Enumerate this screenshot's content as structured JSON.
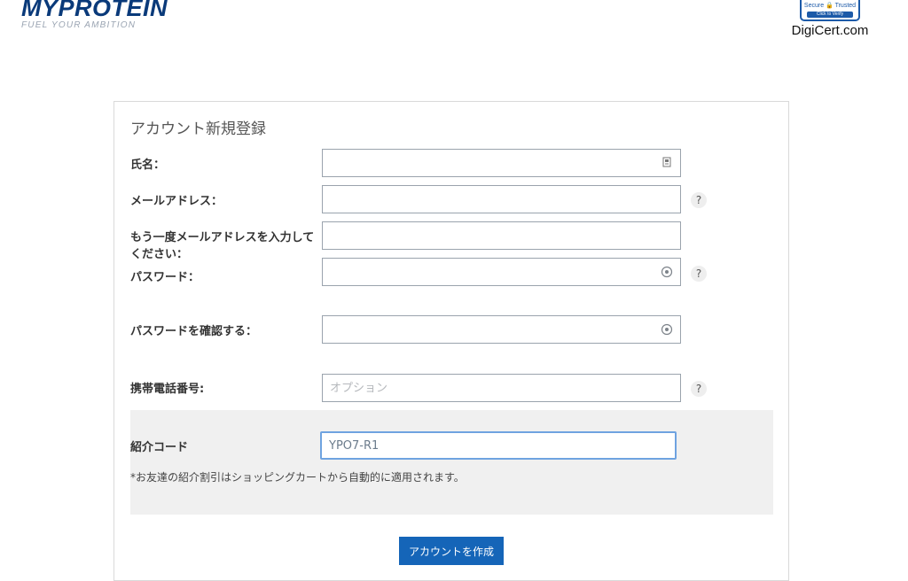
{
  "header": {
    "logo": "MYPROTEIN",
    "tagline": "FUEL YOUR AMBITION",
    "seal": {
      "secure_text": "Secure 🔒 Trusted",
      "verify_text": "Click to Verify",
      "name": "DigiCert.com"
    }
  },
  "form": {
    "title": "アカウント新規登録",
    "fields": {
      "name": {
        "label": "氏名：",
        "value": "",
        "placeholder": ""
      },
      "email": {
        "label": "メールアドレス：",
        "value": "",
        "placeholder": ""
      },
      "email_confirm": {
        "label_line1": "もう一度メールアドレスを入力して",
        "label_line2": "ください：",
        "value": "",
        "placeholder": ""
      },
      "password": {
        "label": "パスワード：",
        "value": "",
        "placeholder": ""
      },
      "password_confirm": {
        "label": "パスワードを確認する：",
        "value": "",
        "placeholder": ""
      },
      "phone": {
        "label": "携帯電話番号:",
        "value": "",
        "placeholder": "オプション"
      },
      "referral": {
        "label": "紹介コード",
        "value": "YPO7-R1",
        "placeholder": ""
      }
    },
    "help_symbol": "?",
    "referral_note": "*お友達の紹介割引はショッピングカートから自動的に適用されます。",
    "submit_label": "アカウントを作成"
  },
  "icons": {
    "name_field": "contact-card-icon",
    "password_field": "eye-icon",
    "password_confirm_field": "eye-icon"
  }
}
